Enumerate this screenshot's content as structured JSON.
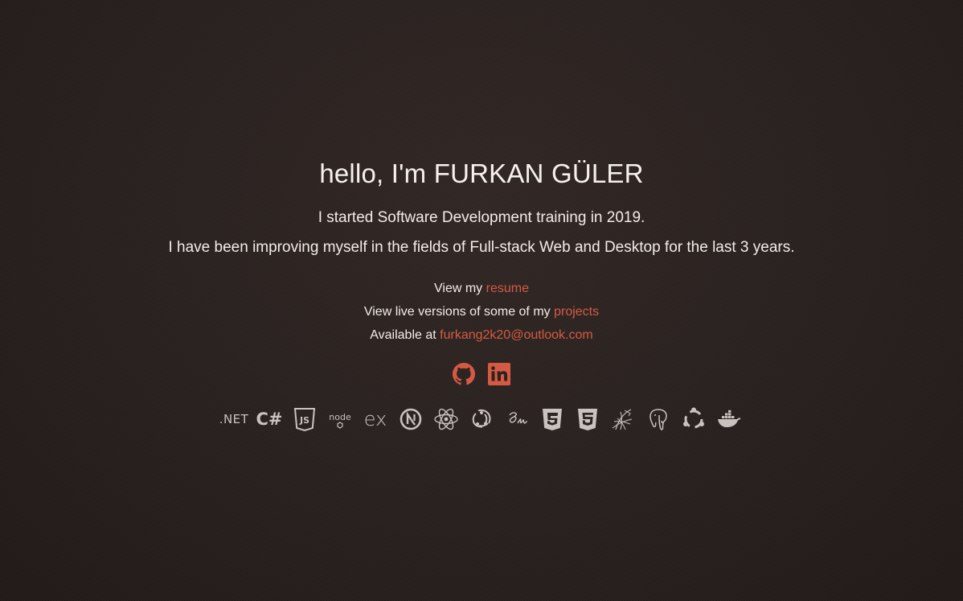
{
  "hero": {
    "title": "hello, I'm FURKAN GÜLER",
    "intro_line1": "I started Software Development training in 2019.",
    "intro_line2": "I have been improving myself in the fields of Full-stack Web and Desktop for the last 3 years."
  },
  "links": {
    "resume_prefix": "View my ",
    "resume_link": "resume",
    "projects_prefix": "View live versions of some of my ",
    "projects_link": "projects",
    "email_prefix": "Available at ",
    "email_link": "furkang2k20@outlook.com"
  },
  "socials": {
    "icons": [
      "github-icon",
      "linkedin-icon"
    ],
    "accent_color": "#d65a43"
  },
  "tech": {
    "dotnet": ".NET",
    "csharp": "C#",
    "js": "JS",
    "node": "node",
    "express": "ex",
    "icons": [
      "dotnet-icon",
      "csharp-icon",
      "javascript-icon",
      "nodejs-icon",
      "express-icon",
      "nextjs-icon",
      "react-icon",
      "redux-icon",
      "sass-icon",
      "css3-icon",
      "html5-icon",
      "mssql-icon",
      "postgresql-icon",
      "ubuntu-icon",
      "docker-icon"
    ]
  },
  "colors": {
    "background": "#2b2321",
    "text": "#f2ece8",
    "accent": "#d65a43",
    "icon": "#c9c2be"
  }
}
